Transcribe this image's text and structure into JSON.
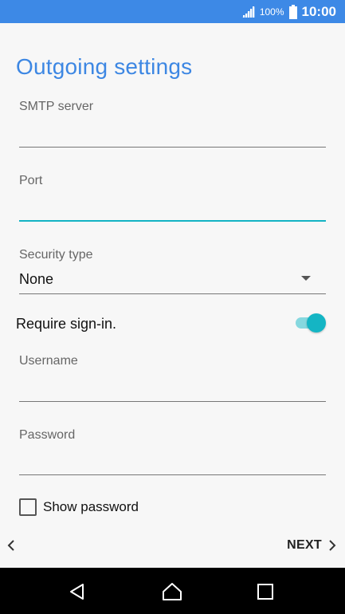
{
  "status_bar": {
    "battery_percent": "100%",
    "time": "10:00",
    "icons": [
      "signal-icon",
      "battery-icon"
    ]
  },
  "page": {
    "title": "Outgoing settings"
  },
  "fields": {
    "smtp_server": {
      "label": "SMTP server",
      "value": ""
    },
    "port": {
      "label": "Port",
      "value": ""
    },
    "security_type": {
      "label": "Security type",
      "value": "None"
    },
    "username": {
      "label": "Username",
      "value": ""
    },
    "password": {
      "label": "Password",
      "value": ""
    }
  },
  "require_signin": {
    "label": "Require sign-in.",
    "enabled": true
  },
  "show_password": {
    "label": "Show password",
    "checked": false
  },
  "footer": {
    "next_label": "NEXT"
  },
  "nav": {
    "buttons": [
      "back-triangle-icon",
      "home-icon",
      "recents-icon"
    ]
  },
  "colors": {
    "status_bar": "#3d89e6",
    "title": "#3d87e3",
    "accent": "#14b5c4",
    "background": "#f7f7f7"
  }
}
